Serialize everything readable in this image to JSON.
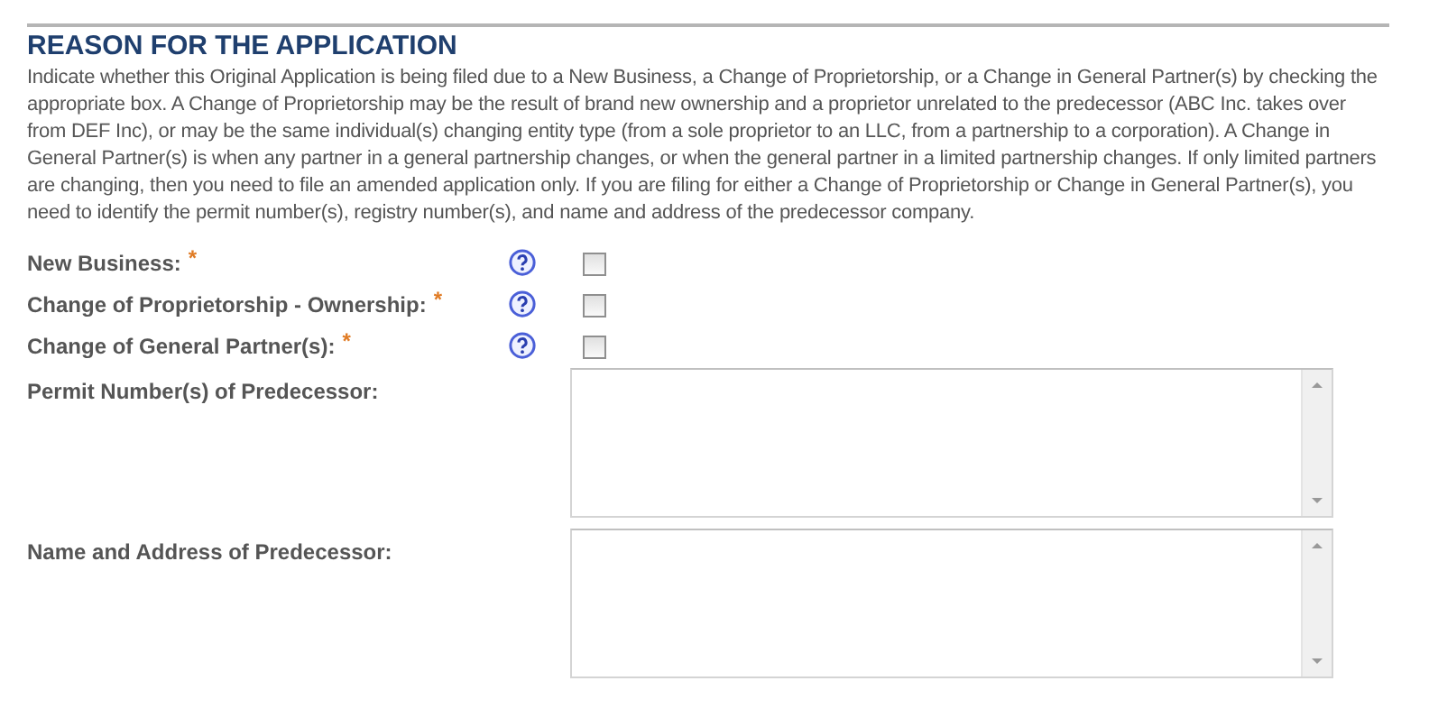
{
  "section": {
    "title": "REASON FOR THE APPLICATION",
    "description": "Indicate whether this Original Application is being filed due to a New Business, a Change of Proprietorship, or a Change in General Partner(s) by checking the appropriate box. A Change of Proprietorship may be the result of brand new ownership and a proprietor unrelated to the predecessor (ABC Inc. takes over from DEF Inc), or may be the same individual(s) changing entity type (from a sole proprietor to an LLC, from a partnership to a corporation). A Change in General Partner(s) is when any partner in a general partnership changes, or when the general partner in a limited partnership changes. If only limited partners are changing, then you need to file an amended application only. If you are filing for either a Change of Proprietorship or Change in General Partner(s), you need to identify the permit number(s), registry number(s), and name and address of the predecessor company."
  },
  "fields": [
    {
      "kind": "checkbox",
      "label": "New Business:",
      "required": true,
      "required_mark": "*",
      "help": true,
      "checked": false
    },
    {
      "kind": "checkbox",
      "label": "Change of Proprietorship - Ownership:",
      "required": true,
      "required_mark": "*",
      "help": true,
      "checked": false
    },
    {
      "kind": "checkbox",
      "label": "Change of General Partner(s):",
      "required": true,
      "required_mark": "*",
      "help": true,
      "checked": false
    },
    {
      "kind": "textarea",
      "label": "Permit Number(s) of Predecessor:",
      "required": false,
      "help": false
    },
    {
      "kind": "textarea",
      "label": "Name and Address of Predecessor:",
      "required": false,
      "help": false
    }
  ]
}
